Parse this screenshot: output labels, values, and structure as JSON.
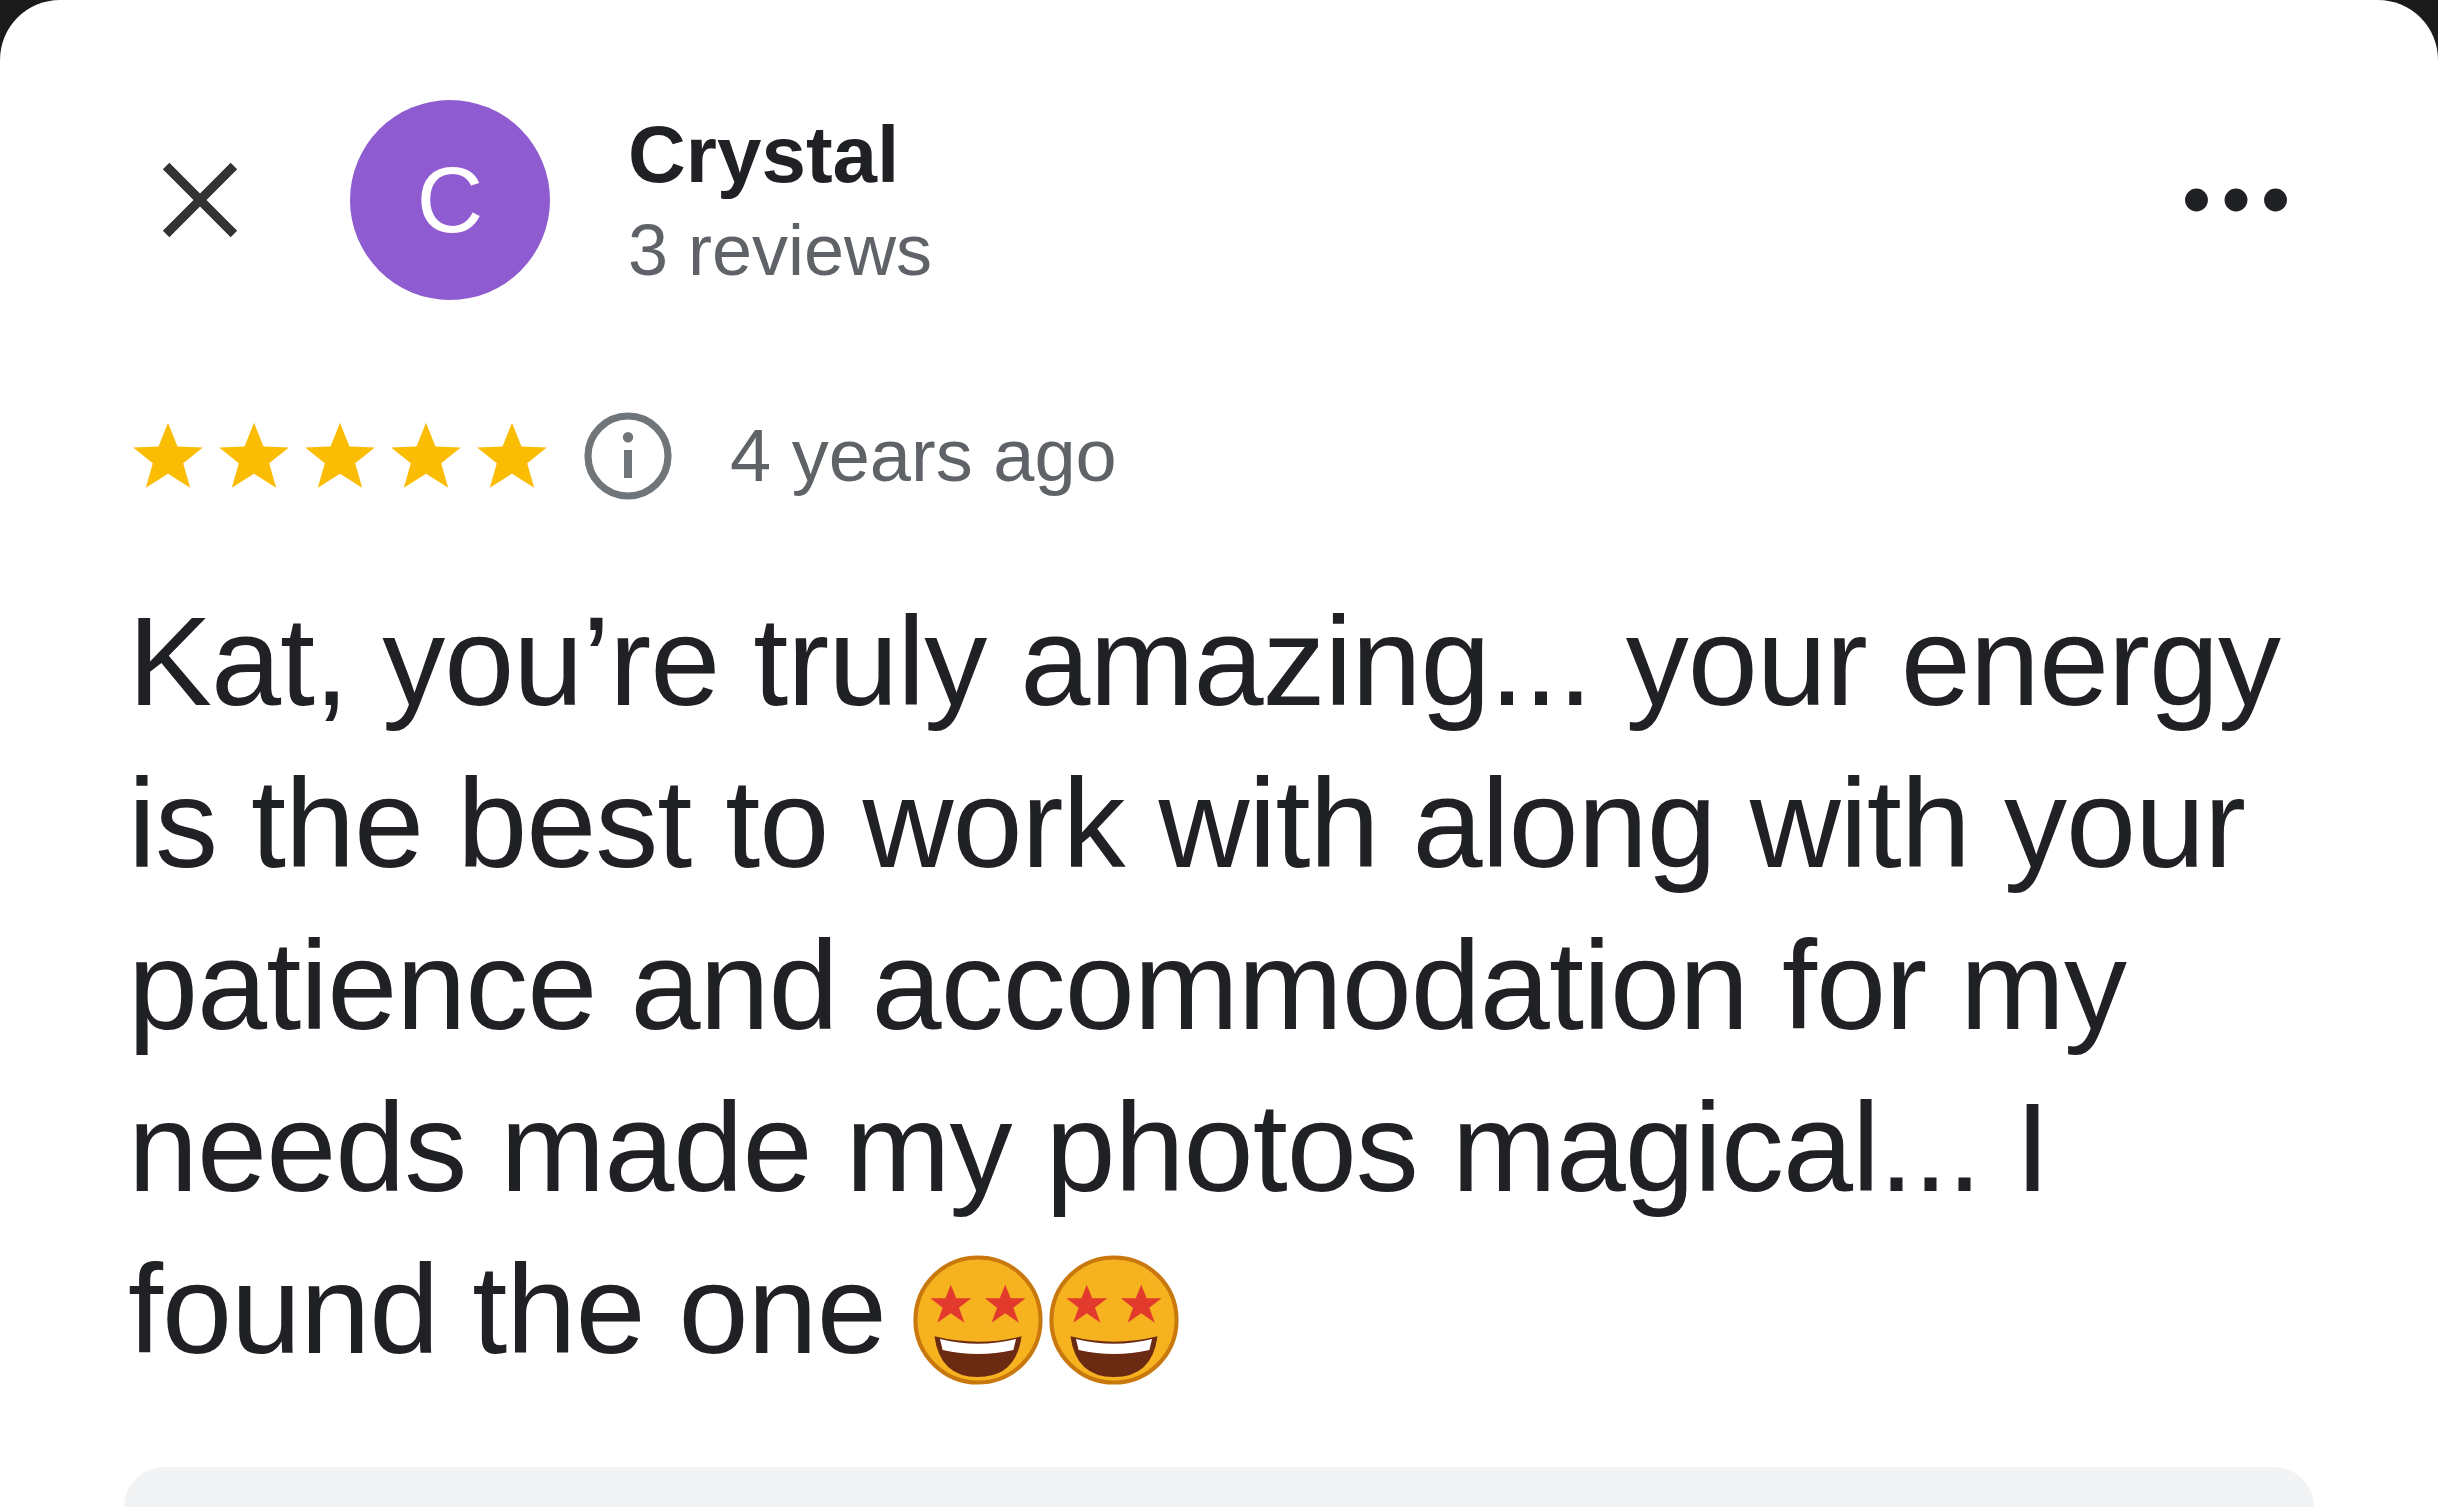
{
  "reviewer": {
    "initial": "C",
    "name": "Crystal",
    "reviews": "3 reviews"
  },
  "review": {
    "stars": 5,
    "time": "4 years ago",
    "text": "Kat, you’re truly amazing... your energy is the best to work with along with your patience and accommodation for my needs made my photos magical... I found the one",
    "emojis": [
      {
        "kind": "star-struck"
      },
      {
        "kind": "star-struck"
      }
    ]
  }
}
